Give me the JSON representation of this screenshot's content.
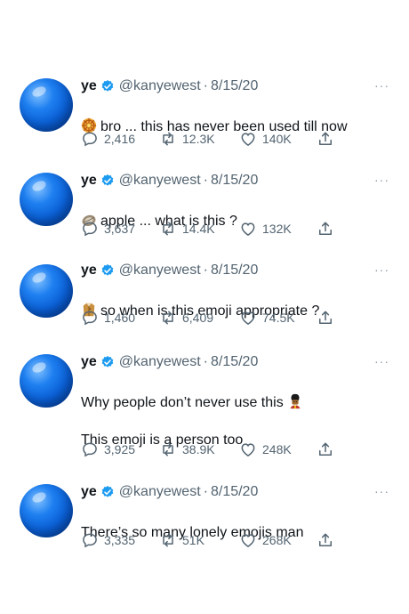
{
  "tweets": [
    {
      "name": "ye",
      "handle": "@kanyewest",
      "date": "8/15/20",
      "text": "bro ... this has never been used till now",
      "emoji": "sun-wheel-emoji",
      "replies": "2,416",
      "retweets": "12.3K",
      "likes": "140K"
    },
    {
      "name": "ye",
      "handle": "@kanyewest",
      "date": "8/15/20",
      "text": "apple ... what is this ?",
      "emoji": "oyster-emoji",
      "replies": "3,637",
      "retweets": "14.4K",
      "likes": "132K"
    },
    {
      "name": "ye",
      "handle": "@kanyewest",
      "date": "8/15/20",
      "text": "so when is this emoji appropriate ?",
      "emoji": "coat-emoji",
      "replies": "1,460",
      "retweets": "6,409",
      "likes": "74.5K"
    },
    {
      "name": "ye",
      "handle": "@kanyewest",
      "date": "8/15/20",
      "text": "Why people don’t never use this",
      "text2": "This emoji is a person too",
      "emoji": "guard-emoji",
      "replies": "3,925",
      "retweets": "38.9K",
      "likes": "248K"
    },
    {
      "name": "ye",
      "handle": "@kanyewest",
      "date": "8/15/20",
      "text": "There’s so many lonely emojis man",
      "replies": "3,335",
      "retweets": "51K",
      "likes": "268K"
    }
  ],
  "separator": "·",
  "more_label": "···",
  "colors": {
    "verified": "#1d9bf0",
    "secondary_text": "#536471",
    "avatar": "#0a5fd6"
  },
  "icons": [
    "verified-badge-icon",
    "reply-icon",
    "retweet-icon",
    "like-icon",
    "share-icon",
    "more-icon"
  ]
}
